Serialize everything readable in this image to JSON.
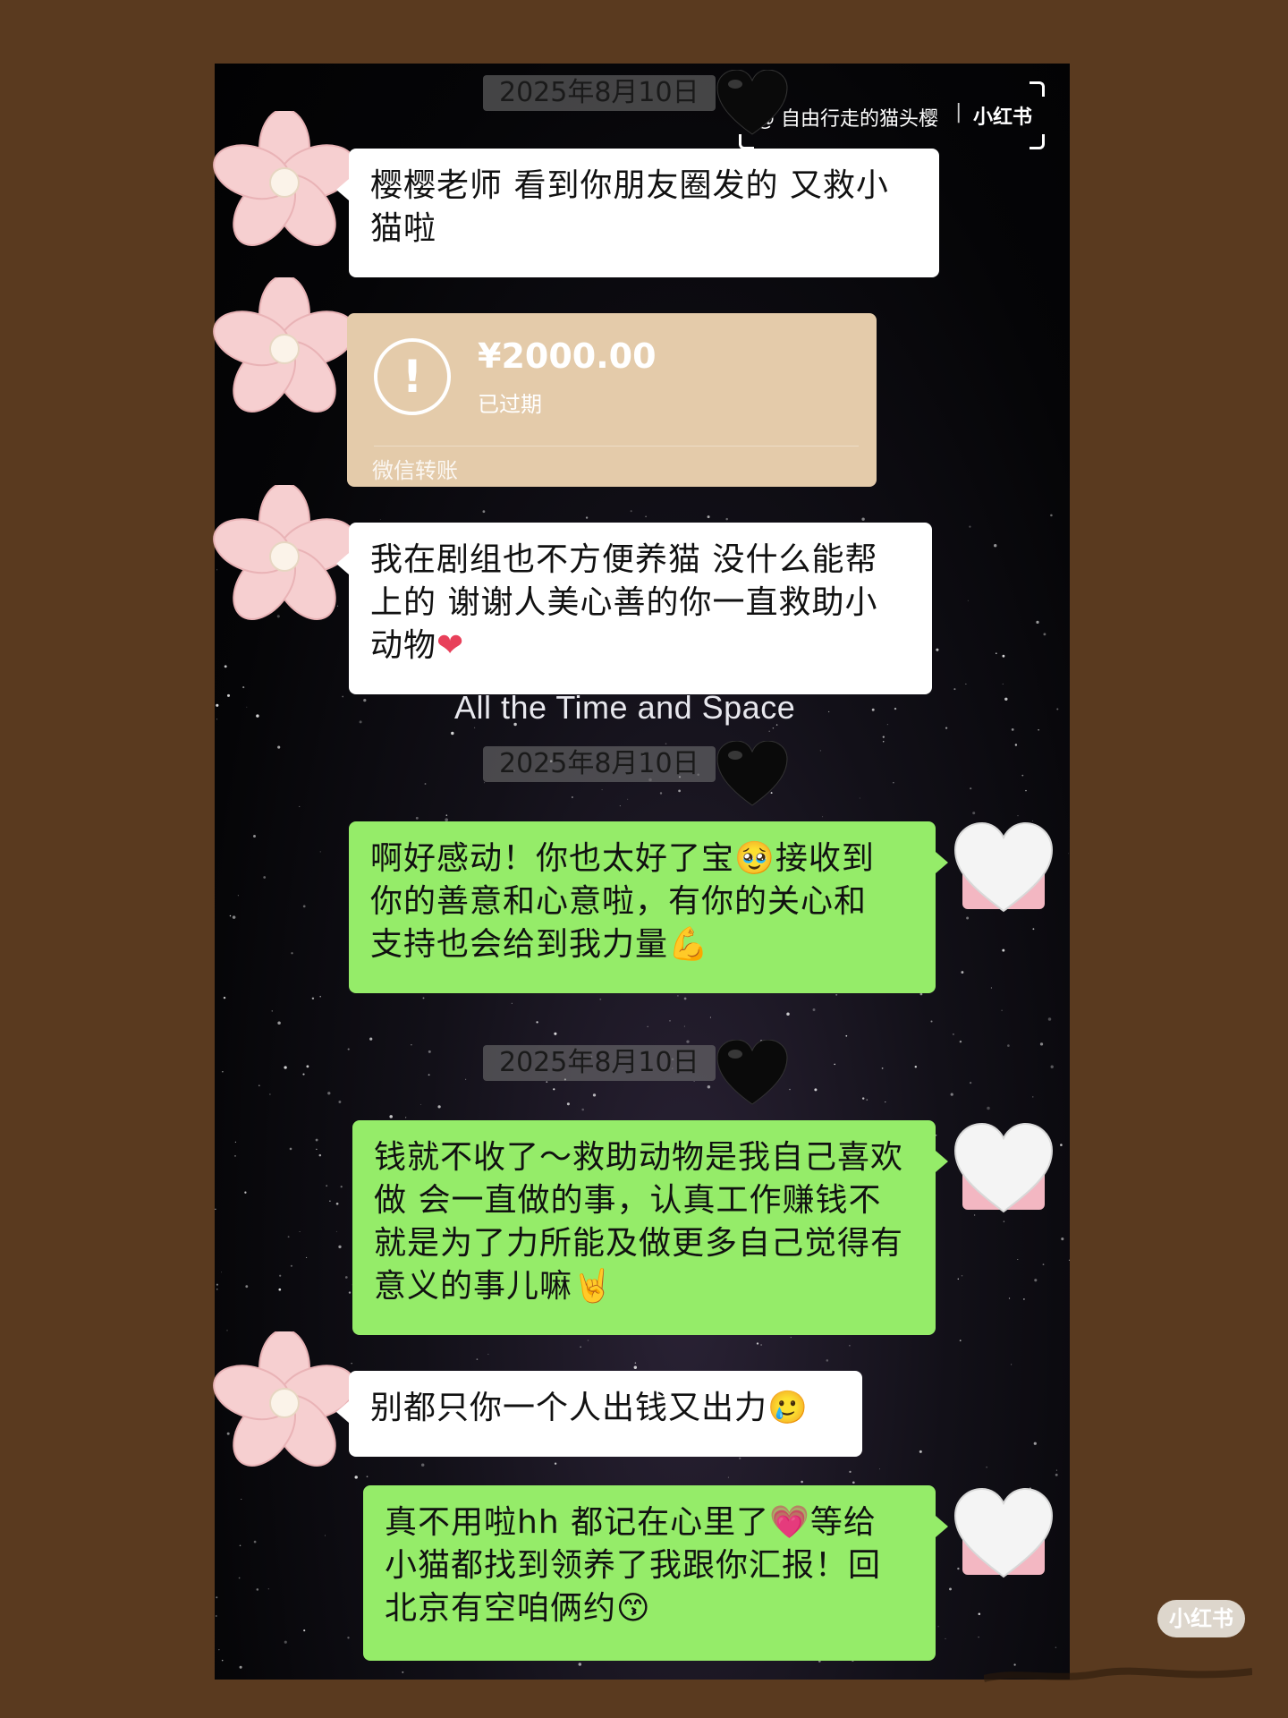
{
  "watermark": {
    "user": "@ 自由行走的猫头樱",
    "separator": "|",
    "brand": "小红书"
  },
  "timestamps": [
    "2025年8月10日",
    "2025年8月10日",
    "2025年8月10日"
  ],
  "messages": [
    {
      "side": "left",
      "text": "樱樱老师 看到你朋友圈发的 又救小猫啦"
    },
    {
      "side": "left",
      "type": "transfer"
    },
    {
      "side": "left",
      "text": "我在剧组也不方便养猫 没什么能帮上的 谢谢人美心善的你一直救助小动物",
      "emoji": "❤"
    },
    {
      "side": "right",
      "line1a": "啊好感动！你也太好了宝",
      "line1b": "接收到",
      "line2": "你的善意和心意啦，有你的关心和",
      "line3": "支持也会给到我力量",
      "emoji_a": "🥹",
      "emoji_b": "💪"
    },
    {
      "side": "right",
      "text": "钱就不收了～救助动物是我自己喜欢做 会一直做的事，认真工作赚钱不就是为了力所能及做更多自己觉得有意义的事儿嘛",
      "emoji": "🤘"
    },
    {
      "side": "left",
      "text": "别都只你一个人出钱又出力",
      "emoji": "🥲"
    },
    {
      "side": "right",
      "line1a": "真不用啦hh 都记在心里了",
      "line1b": "等给",
      "line2": "小猫都找到领养了我跟你汇报！回",
      "line3": "北京有空咱俩约",
      "emoji_a": "💗",
      "emoji_b": "😙"
    }
  ],
  "transfer": {
    "icon": "!",
    "amount": "¥2000.00",
    "status": "已过期",
    "label": "微信转账"
  },
  "background_text": "All the Time and Space",
  "badge": "小红书",
  "colors": {
    "outer_bg": "#5a3a1f",
    "green_bubble": "#95ec69",
    "white_bubble": "#ffffff",
    "transfer_bg": "#e4cbaa",
    "flower": "#f6cfd0"
  }
}
